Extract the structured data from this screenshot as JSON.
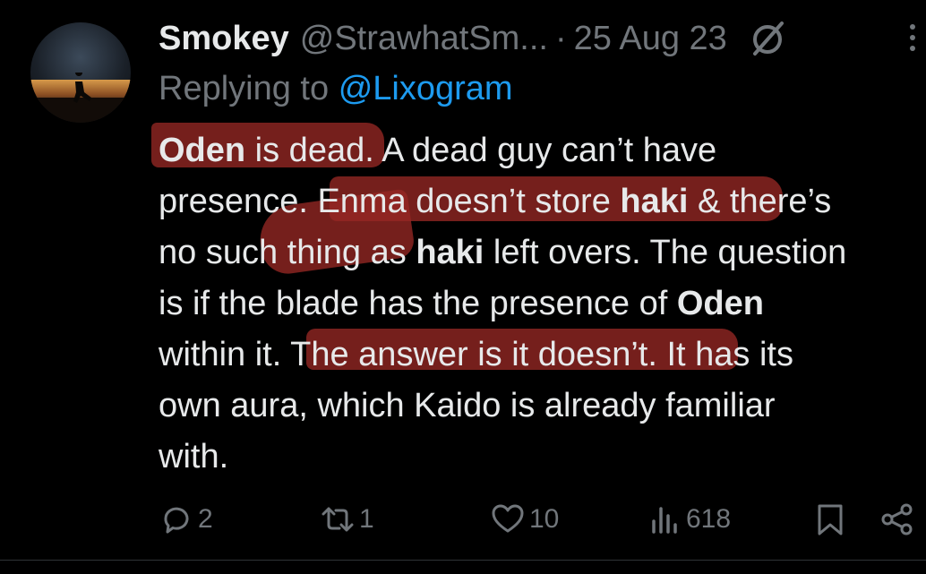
{
  "tweet": {
    "author_name": "Smokey",
    "author_handle": "@StrawhatSm...",
    "separator": "·",
    "date": "25 Aug 23",
    "replying_to_label": "Replying to",
    "replying_to_handle": "@Lixogram",
    "body_lines": [
      [
        {
          "t": "Oden",
          "b": true
        },
        {
          "t": " is dead. A dead guy can’t have"
        }
      ],
      [
        {
          "t": "presence. Enma doesn’t store "
        },
        {
          "t": "haki",
          "b": true
        },
        {
          "t": " & there’s"
        }
      ],
      [
        {
          "t": "no such thing as "
        },
        {
          "t": "haki",
          "b": true
        },
        {
          "t": " left overs. The question"
        }
      ],
      [
        {
          "t": "is if the blade has the presence of "
        },
        {
          "t": "Oden",
          "b": true
        }
      ],
      [
        {
          "t": "within it. The answer is it doesn’t. It has its"
        }
      ],
      [
        {
          "t": "own aura, which Kaido is already familiar"
        }
      ],
      [
        {
          "t": "with."
        }
      ]
    ],
    "stats": {
      "replies": "2",
      "reposts": "1",
      "likes": "10",
      "views": "618"
    }
  },
  "icons": {
    "header": [
      "grok-icon",
      "more-icon"
    ],
    "actions": [
      "reply-icon",
      "repost-icon",
      "like-icon",
      "views-icon",
      "bookmark-icon",
      "share-icon"
    ]
  },
  "colors": {
    "background": "#000000",
    "text": "#e7e9ea",
    "muted": "#71767b",
    "link": "#1d9bf0",
    "highlight": "#962824"
  }
}
